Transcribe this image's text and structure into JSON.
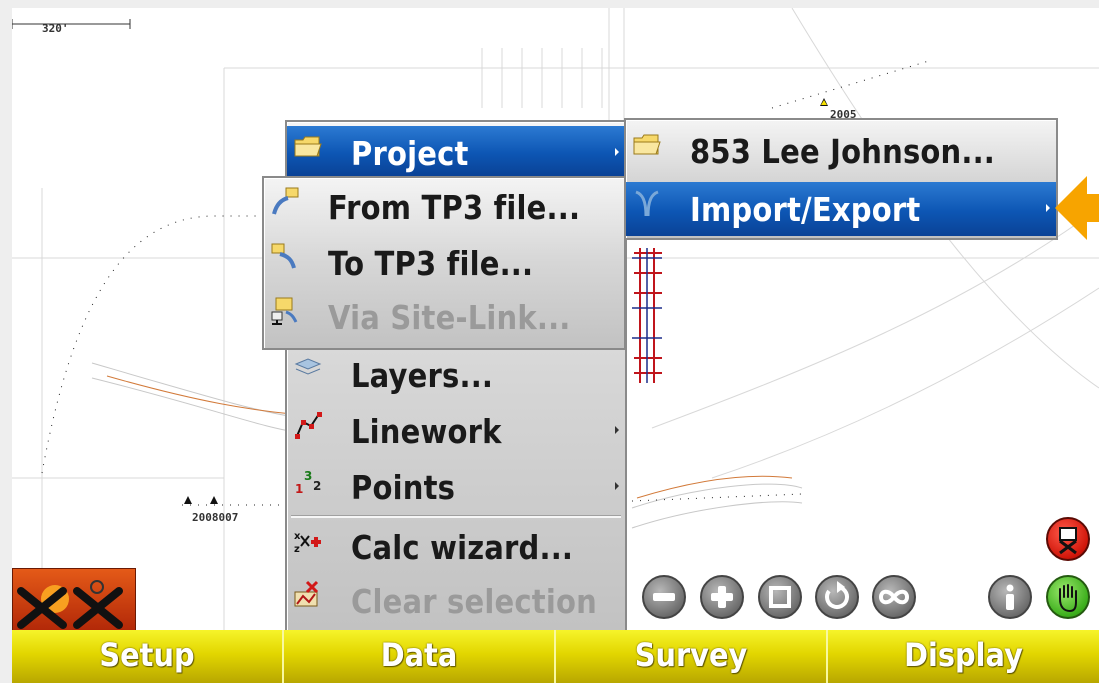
{
  "map": {
    "scale_label": "320'",
    "lot_label_top": "2005",
    "lot_label_bottom": "2008007"
  },
  "main_menu": {
    "items": [
      {
        "label": "Project",
        "icon": "folder-icon",
        "selected": true,
        "has_submenu": true
      },
      {
        "label": "Layers...",
        "icon": "layers-icon"
      },
      {
        "label": "Linework",
        "icon": "linework-icon",
        "has_submenu": true
      },
      {
        "label": "Points",
        "icon": "points-icon",
        "has_submenu": true
      },
      {
        "label": "Calc wizard...",
        "icon": "calc-wizard-icon"
      },
      {
        "label": "Clear selection",
        "icon": "clear-selection-icon",
        "disabled": true
      }
    ]
  },
  "project_submenu": {
    "items": [
      {
        "label": "853 Lee Johnson...",
        "icon": "folder-icon"
      },
      {
        "label": "Import/Export",
        "icon": "import-export-icon",
        "selected": true,
        "has_submenu": true
      }
    ]
  },
  "tp3_submenu": {
    "items": [
      {
        "label": "From TP3 file...",
        "icon": "import-icon"
      },
      {
        "label": "To TP3 file...",
        "icon": "export-icon"
      },
      {
        "label": "Via Site-Link...",
        "icon": "site-link-icon",
        "disabled": true
      }
    ]
  },
  "toolbar": {
    "icons": [
      "zoom-out-icon",
      "zoom-in-icon",
      "zoom-extents-icon",
      "rotate-icon",
      "infinity-icon",
      "info-icon",
      "pan-hand-icon",
      "target-icon",
      "satellite-status-icon"
    ]
  },
  "tabs": [
    {
      "label": "Setup"
    },
    {
      "label": "Data"
    },
    {
      "label": "Survey"
    },
    {
      "label": "Display"
    }
  ],
  "colors": {
    "selection_blue": "#0d56b4",
    "tab_yellow": "#e2d600",
    "arrow_orange": "#f7a400"
  }
}
